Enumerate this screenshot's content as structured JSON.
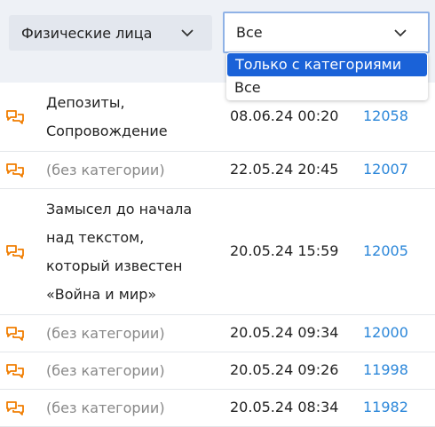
{
  "filters": {
    "type_value": "Физические лица",
    "category_value": "Все",
    "category_options": [
      "Только с категориями",
      "Все"
    ]
  },
  "colors": {
    "accent": "#1a62d8",
    "link": "#2a86d9",
    "icon": "#f07d00",
    "muted": "#888888"
  },
  "rows": [
    {
      "icon": "chat-icon",
      "desc_lines": [
        "Депозиты,",
        "Сопровождение"
      ],
      "date": "08.06.24 00:20",
      "number": "12058"
    },
    {
      "icon": "chat-icon",
      "desc_lines": [
        "(без категории)"
      ],
      "date": "22.05.24 20:45",
      "number": "12007"
    },
    {
      "icon": "chat-icon",
      "desc_lines": [
        "Замысел до начала",
        "над текстом,",
        "который известен",
        "«Война и мир»"
      ],
      "date": "20.05.24 15:59",
      "number": "12005"
    },
    {
      "icon": "chat-icon",
      "desc_lines": [
        "(без категории)"
      ],
      "date": "20.05.24 09:34",
      "number": "12000"
    },
    {
      "icon": "chat-icon",
      "desc_lines": [
        "(без категории)"
      ],
      "date": "20.05.24 09:26",
      "number": "11998"
    },
    {
      "icon": "chat-icon",
      "desc_lines": [
        "(без категории)"
      ],
      "date": "20.05.24 08:34",
      "number": "11982"
    }
  ]
}
